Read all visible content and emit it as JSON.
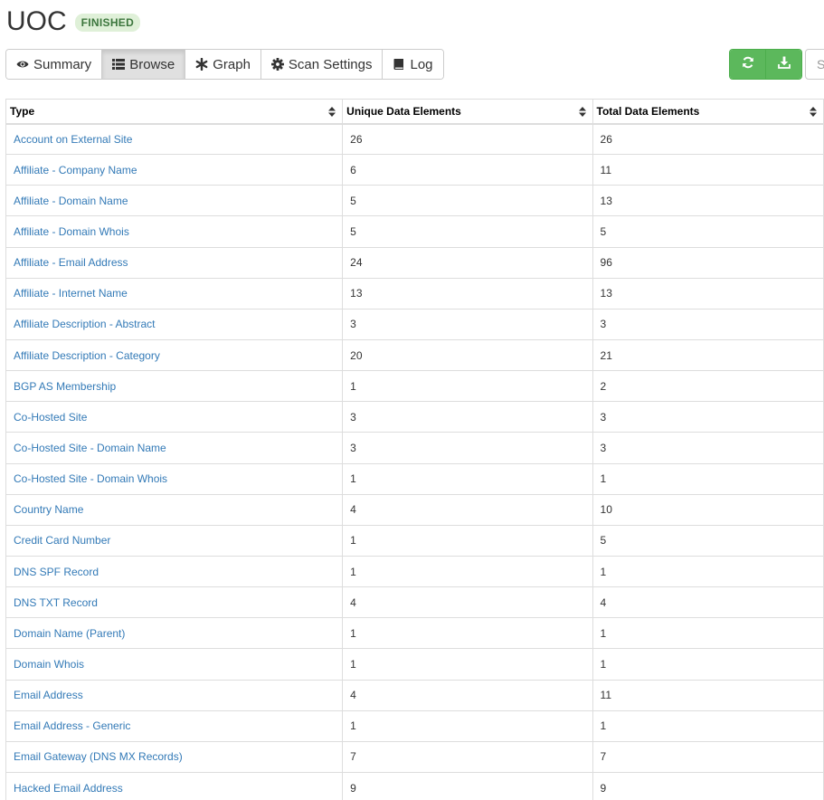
{
  "header": {
    "scan_name": "UOC",
    "status": "FINISHED"
  },
  "tabs": [
    {
      "label": "Summary",
      "icon": "eye-icon",
      "active": false
    },
    {
      "label": "Browse",
      "icon": "list-icon",
      "active": true
    },
    {
      "label": "Graph",
      "icon": "asterisk-icon",
      "active": false
    },
    {
      "label": "Scan Settings",
      "icon": "gear-icon",
      "active": false
    },
    {
      "label": "Log",
      "icon": "book-icon",
      "active": false
    }
  ],
  "actions": {
    "refresh_icon": "refresh-icon",
    "download_icon": "download-icon",
    "accent_color": "#5cb85c"
  },
  "search": {
    "placeholder": "Search..."
  },
  "table": {
    "columns": [
      "Type",
      "Unique Data Elements",
      "Total Data Elements"
    ],
    "rows": [
      {
        "type": "Account on External Site",
        "unique": "26",
        "total": "26"
      },
      {
        "type": "Affiliate - Company Name",
        "unique": "6",
        "total": "11"
      },
      {
        "type": "Affiliate - Domain Name",
        "unique": "5",
        "total": "13"
      },
      {
        "type": "Affiliate - Domain Whois",
        "unique": "5",
        "total": "5"
      },
      {
        "type": "Affiliate - Email Address",
        "unique": "24",
        "total": "96"
      },
      {
        "type": "Affiliate - Internet Name",
        "unique": "13",
        "total": "13"
      },
      {
        "type": "Affiliate Description - Abstract",
        "unique": "3",
        "total": "3"
      },
      {
        "type": "Affiliate Description - Category",
        "unique": "20",
        "total": "21"
      },
      {
        "type": "BGP AS Membership",
        "unique": "1",
        "total": "2"
      },
      {
        "type": "Co-Hosted Site",
        "unique": "3",
        "total": "3"
      },
      {
        "type": "Co-Hosted Site - Domain Name",
        "unique": "3",
        "total": "3"
      },
      {
        "type": "Co-Hosted Site - Domain Whois",
        "unique": "1",
        "total": "1"
      },
      {
        "type": "Country Name",
        "unique": "4",
        "total": "10"
      },
      {
        "type": "Credit Card Number",
        "unique": "1",
        "total": "5"
      },
      {
        "type": "DNS SPF Record",
        "unique": "1",
        "total": "1"
      },
      {
        "type": "DNS TXT Record",
        "unique": "4",
        "total": "4"
      },
      {
        "type": "Domain Name (Parent)",
        "unique": "1",
        "total": "1"
      },
      {
        "type": "Domain Whois",
        "unique": "1",
        "total": "1"
      },
      {
        "type": "Email Address",
        "unique": "4",
        "total": "11"
      },
      {
        "type": "Email Address - Generic",
        "unique": "1",
        "total": "1"
      },
      {
        "type": "Email Gateway (DNS MX Records)",
        "unique": "7",
        "total": "7"
      },
      {
        "type": "Hacked Email Address",
        "unique": "9",
        "total": "9"
      }
    ]
  }
}
